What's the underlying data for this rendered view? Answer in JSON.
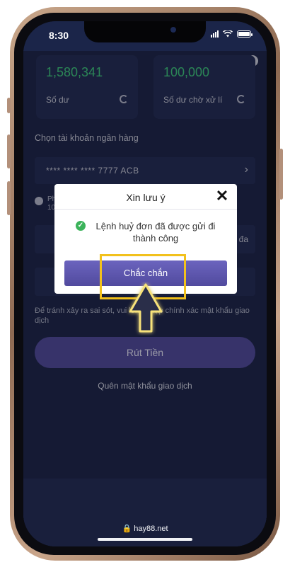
{
  "status_bar": {
    "time": "8:30"
  },
  "balances": [
    {
      "value": "1,580,341",
      "label": "Số dư"
    },
    {
      "value": "100,000",
      "label": "Số dư chờ xử lí"
    }
  ],
  "bank": {
    "section_label": "Chọn tài khoản ngân hàng",
    "account": "**** **** **** 7777 ACB"
  },
  "notice": {
    "text": "Ph... 10..."
  },
  "form": {
    "amount_suffix": "Tối đa",
    "helper_text": "Để tránh xảy ra sai sót, vui lòng nhập chính xác mật khẩu giao dịch",
    "withdraw_label": "Rút Tiền",
    "forgot_label": "Quên mật khẩu giao dịch"
  },
  "modal": {
    "title": "Xin lưu ý",
    "message": "Lệnh huỷ đơn đã được gửi đi thành công",
    "confirm_label": "Chắc chắn"
  },
  "footer": {
    "url": "hay88.net"
  },
  "colors": {
    "app_background": "#1c2446",
    "card": "#232c52",
    "balance_green": "#3ec97a",
    "primary_button": "#514a99",
    "highlight": "#f2c11c",
    "success": "#3bb35a"
  },
  "icons": {
    "info": "info-icon",
    "refresh": "refresh-icon",
    "chevron": "chevron-right-icon",
    "close": "close-icon",
    "check": "check-circle-icon",
    "cursor": "arrow-cursor-icon"
  }
}
